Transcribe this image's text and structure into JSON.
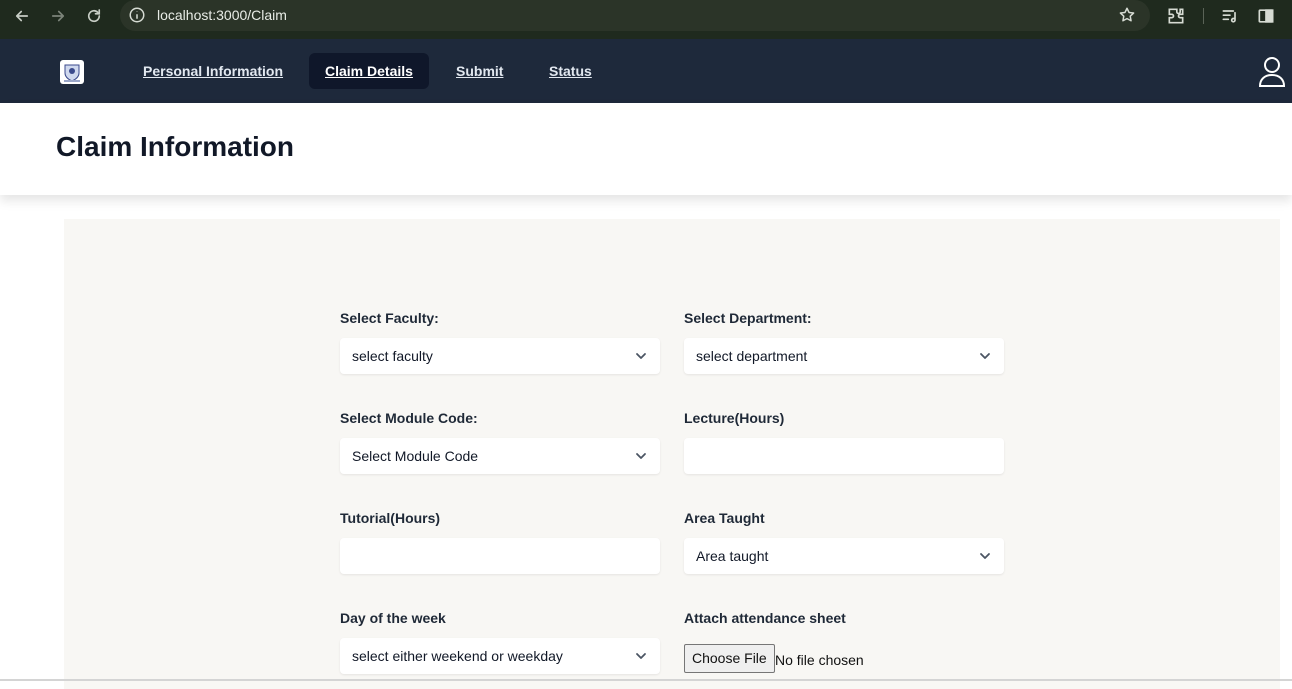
{
  "browser": {
    "url": "localhost:3000/Claim",
    "icons": [
      "back-arrow-icon",
      "forward-arrow-icon",
      "reload-icon",
      "info-icon",
      "star-icon",
      "extensions-icon",
      "reading-list-icon",
      "side-panel-icon"
    ]
  },
  "header": {
    "logo": "university-crest-logo",
    "nav": [
      {
        "label": "Personal Information",
        "active": false
      },
      {
        "label": "Claim Details",
        "active": true
      },
      {
        "label": "Submit",
        "active": false
      },
      {
        "label": "Status",
        "active": false
      }
    ],
    "user_icon": "user-icon"
  },
  "page": {
    "title": "Claim Information"
  },
  "form": {
    "faculty": {
      "label": "Select Faculty:",
      "value": "select faculty"
    },
    "department": {
      "label": "Select Department:",
      "value": "select department"
    },
    "module_code": {
      "label": "Select Module Code:",
      "value": "Select Module Code"
    },
    "lecture_hours": {
      "label": "Lecture(Hours)",
      "value": ""
    },
    "tutorial_hours": {
      "label": "Tutorial(Hours)",
      "value": ""
    },
    "area_taught": {
      "label": "Area Taught",
      "value": "Area taught"
    },
    "day_of_week": {
      "label": "Day of the week",
      "value": "select either weekend or weekday"
    },
    "attendance": {
      "label": "Attach attendance sheet",
      "button": "Choose File",
      "status": "No file chosen"
    }
  },
  "colors": {
    "chrome_bg": "#1f2a1e",
    "appbar_bg": "#1e293b",
    "active_tab_bg": "#0f172a",
    "form_bg": "#f8f7f4"
  }
}
